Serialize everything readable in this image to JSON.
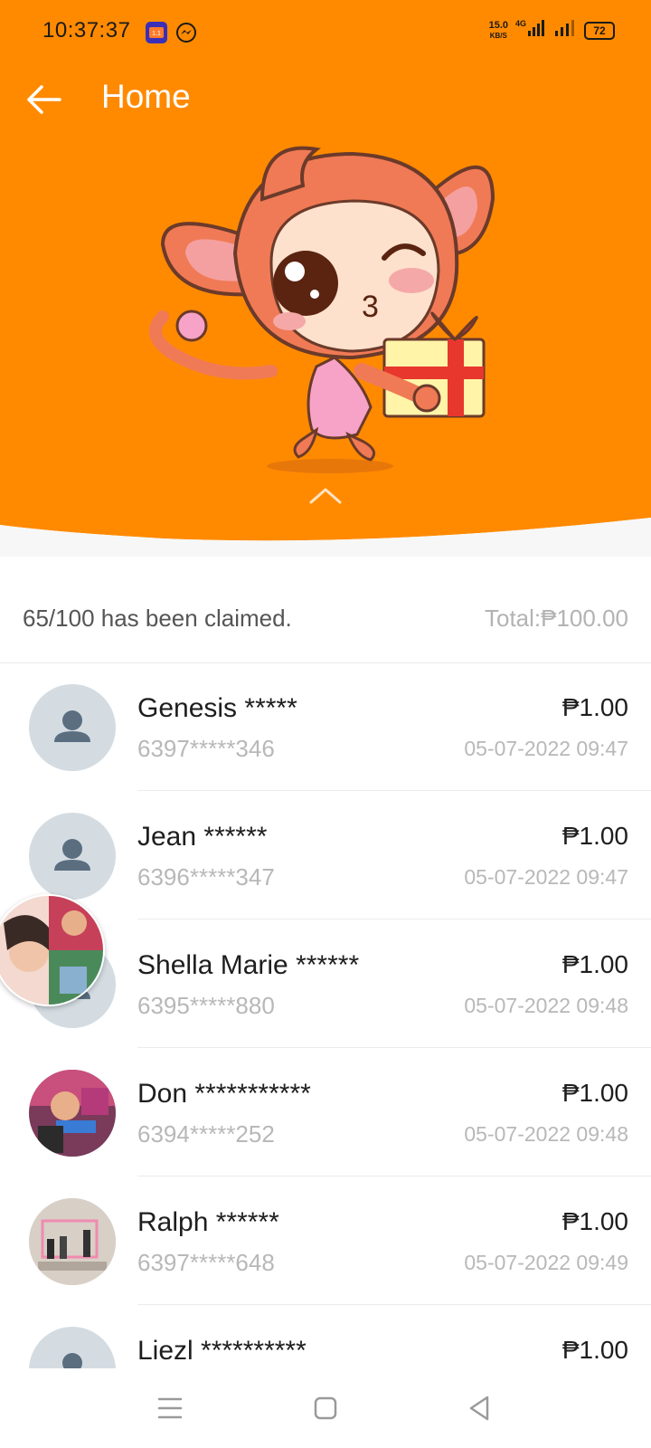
{
  "status_bar": {
    "time": "10:37:37",
    "net_speed_value": "15.0",
    "net_speed_unit": "KB/S",
    "network": "4G",
    "battery": "72",
    "icons": [
      "lazada-app-icon",
      "messenger-icon",
      "signal-icon",
      "wifi-icon",
      "battery-icon"
    ]
  },
  "header": {
    "title": "Home",
    "background_color": "#FF8A00",
    "illustration": "monkey-with-gift"
  },
  "summary": {
    "claimed_text": "65/100 has been claimed.",
    "total_text": "Total:₱100.00"
  },
  "recipients": [
    {
      "name": "Genesis *****",
      "phone": "6397*****346",
      "amount": "₱1.00",
      "date": "05-07-2022 09:47",
      "avatar": "default-avatar-icon"
    },
    {
      "name": "Jean ******",
      "phone": "6396*****347",
      "amount": "₱1.00",
      "date": "05-07-2022 09:47",
      "avatar": "default-avatar-icon"
    },
    {
      "name": "Shella Marie ******",
      "phone": "6395*****880",
      "amount": "₱1.00",
      "date": "05-07-2022 09:48",
      "avatar": "default-avatar-icon"
    },
    {
      "name": "Don ***********",
      "phone": "6394*****252",
      "amount": "₱1.00",
      "date": "05-07-2022 09:48",
      "avatar": "photo-avatar"
    },
    {
      "name": "Ralph ******",
      "phone": "6397*****648",
      "amount": "₱1.00",
      "date": "05-07-2022 09:49",
      "avatar": "photo-avatar"
    },
    {
      "name": "Liezl **********",
      "phone": "",
      "amount": "₱1.00",
      "date": "",
      "avatar": "default-avatar-icon"
    }
  ],
  "nav_bar": {
    "buttons": [
      "menu-icon",
      "home-square-icon",
      "back-triangle-icon"
    ]
  }
}
